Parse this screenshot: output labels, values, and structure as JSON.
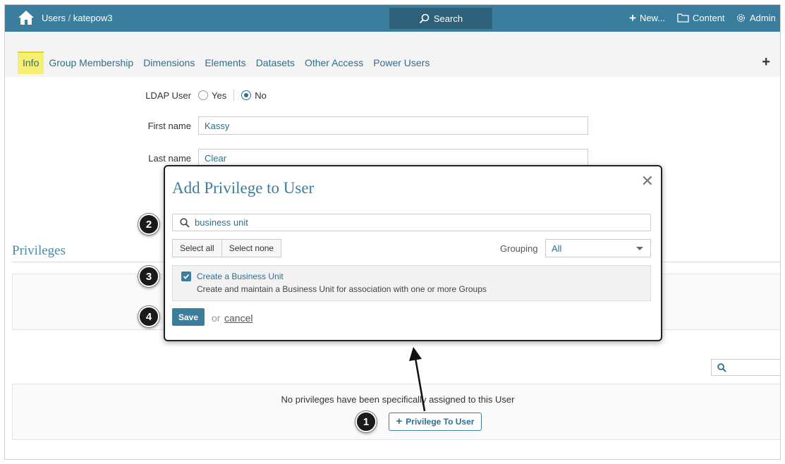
{
  "topbar": {
    "breadcrumb_root": "Users",
    "breadcrumb_sep": " / ",
    "breadcrumb_user": "katepow3",
    "search_label": "Search",
    "new_label": "New...",
    "content_label": "Content",
    "admin_label": "Admin"
  },
  "tabs": [
    {
      "label": "Info",
      "active": true
    },
    {
      "label": "Group Membership"
    },
    {
      "label": "Dimensions"
    },
    {
      "label": "Elements"
    },
    {
      "label": "Datasets"
    },
    {
      "label": "Other Access"
    },
    {
      "label": "Power Users"
    }
  ],
  "form": {
    "ldap_label": "LDAP User",
    "ldap_yes": "Yes",
    "ldap_no": "No",
    "ldap_selected": "No",
    "first_name_label": "First name",
    "first_name_value": "Kassy",
    "last_name_label": "Last name",
    "last_name_value": "Clear"
  },
  "privileges": {
    "title": "Privileges",
    "empty_message": "No privileges have been specifically assigned to this User",
    "add_button": "Privilege To User"
  },
  "modal": {
    "title": "Add Privilege to User",
    "close": "✕",
    "search_value": "business unit",
    "select_all": "Select all",
    "select_none": "Select none",
    "grouping_label": "Grouping",
    "grouping_value": "All",
    "items": [
      {
        "title": "Create a Business Unit",
        "description": "Create and maintain a Business Unit for association with one or more Groups",
        "checked": true
      }
    ],
    "save": "Save",
    "or": "or",
    "cancel": "cancel"
  },
  "callouts": [
    "1",
    "2",
    "3",
    "4"
  ],
  "colors": {
    "topbar": "#3a7d9c",
    "accent": "#2e6f8e",
    "active_tab": "#f5f074"
  }
}
